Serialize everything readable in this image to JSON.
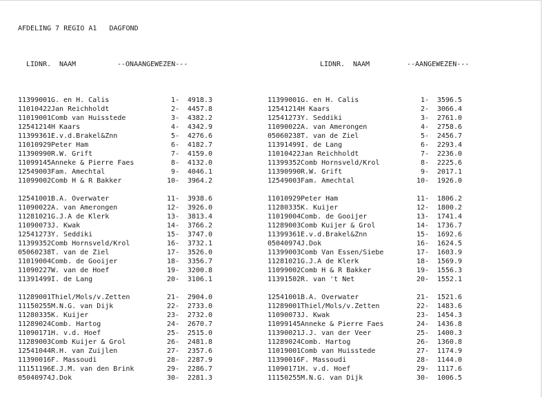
{
  "title_line": "AFDELING 7 REGIO A1   DAGFOND",
  "headers": {
    "left_lidnr": "LIDNR.",
    "left_naam": "NAAM",
    "left_section": "--ONAANGEWEZEN---",
    "right_lidnr": "LIDNR.",
    "right_naam": "NAAM",
    "right_section": "--AANGEWEZEN---"
  },
  "left": [
    {
      "lid": "11399001",
      "naam": "G. en H. Calis",
      "rank": "1-",
      "score": "4918.3"
    },
    {
      "lid": "11010422",
      "naam": "Jan Reichholdt",
      "rank": "2-",
      "score": "4457.8"
    },
    {
      "lid": "11019001",
      "naam": "Comb van Huisstede",
      "rank": "3-",
      "score": "4382.2"
    },
    {
      "lid": "12541214",
      "naam": "H Kaars",
      "rank": "4-",
      "score": "4342.9"
    },
    {
      "lid": "11399361",
      "naam": "E.v.d.Brakel&Znn",
      "rank": "5-",
      "score": "4276.6"
    },
    {
      "lid": "11010929",
      "naam": "Peter Ham",
      "rank": "6-",
      "score": "4182.7"
    },
    {
      "lid": "11390990",
      "naam": "R.W. Grift",
      "rank": "7-",
      "score": "4159.0"
    },
    {
      "lid": "11099145",
      "naam": "Anneke & Pierre Faes",
      "rank": "8-",
      "score": "4132.0"
    },
    {
      "lid": "12549003",
      "naam": "Fam. Amechtal",
      "rank": "9-",
      "score": "4046.1"
    },
    {
      "lid": "11099002",
      "naam": "Comb H & R Bakker",
      "rank": "10-",
      "score": "3964.2"
    },
    {
      "lid": "12541001",
      "naam": "B.A. Overwater",
      "rank": "11-",
      "score": "3938.6"
    },
    {
      "lid": "11090022",
      "naam": "A. van Amerongen",
      "rank": "12-",
      "score": "3926.0"
    },
    {
      "lid": "11281021",
      "naam": "G.J.A de Klerk",
      "rank": "13-",
      "score": "3813.4"
    },
    {
      "lid": "11090073",
      "naam": "J. Kwak",
      "rank": "14-",
      "score": "3766.2"
    },
    {
      "lid": "12541273",
      "naam": "Y. Seddiki",
      "rank": "15-",
      "score": "3747.0"
    },
    {
      "lid": "11399352",
      "naam": "Comb Hornsveld/Krol",
      "rank": "16-",
      "score": "3732.1"
    },
    {
      "lid": "05060238",
      "naam": "T. van de Ziel",
      "rank": "17-",
      "score": "3526.0"
    },
    {
      "lid": "11019004",
      "naam": "Comb. de Gooijer",
      "rank": "18-",
      "score": "3356.7"
    },
    {
      "lid": "11090227",
      "naam": "W. van de Hoef",
      "rank": "19-",
      "score": "3200.8"
    },
    {
      "lid": "11391499",
      "naam": "I. de Lang",
      "rank": "20-",
      "score": "3106.1"
    },
    {
      "lid": "11289001",
      "naam": "Thiel/Mols/v.Zetten",
      "rank": "21-",
      "score": "2904.0"
    },
    {
      "lid": "11150255",
      "naam": "M.N.G. van Dijk",
      "rank": "22-",
      "score": "2733.0"
    },
    {
      "lid": "11280335",
      "naam": "K. Kuijer",
      "rank": "23-",
      "score": "2732.0"
    },
    {
      "lid": "11289024",
      "naam": "Comb. Hartog",
      "rank": "24-",
      "score": "2670.7"
    },
    {
      "lid": "11090171",
      "naam": "H. v.d. Hoef",
      "rank": "25-",
      "score": "2515.0"
    },
    {
      "lid": "11289003",
      "naam": "Comb Kuijer & Grol",
      "rank": "26-",
      "score": "2481.8"
    },
    {
      "lid": "12541044",
      "naam": "R.H. van Zuijlen",
      "rank": "27-",
      "score": "2357.6"
    },
    {
      "lid": "11390016",
      "naam": "F. Massoudi",
      "rank": "28-",
      "score": "2287.9"
    },
    {
      "lid": "11151196",
      "naam": "E.J.M. van den Brink",
      "rank": "29-",
      "score": "2286.7"
    },
    {
      "lid": "05040974",
      "naam": "J.Dok",
      "rank": "30-",
      "score": "2281.3"
    }
  ],
  "right": [
    {
      "lid": "11399001",
      "naam": "G. en H. Calis",
      "rank": "1-",
      "score": "3596.5"
    },
    {
      "lid": "12541214",
      "naam": "H Kaars",
      "rank": "2-",
      "score": "3066.4"
    },
    {
      "lid": "12541273",
      "naam": "Y. Seddiki",
      "rank": "3-",
      "score": "2761.0"
    },
    {
      "lid": "11090022",
      "naam": "A. van Amerongen",
      "rank": "4-",
      "score": "2758.6"
    },
    {
      "lid": "05060238",
      "naam": "T. van de Ziel",
      "rank": "5-",
      "score": "2456.7"
    },
    {
      "lid": "11391499",
      "naam": "I. de Lang",
      "rank": "6-",
      "score": "2293.4"
    },
    {
      "lid": "11010422",
      "naam": "Jan Reichholdt",
      "rank": "7-",
      "score": "2236.0"
    },
    {
      "lid": "11399352",
      "naam": "Comb Hornsveld/Krol",
      "rank": "8-",
      "score": "2225.6"
    },
    {
      "lid": "11390990",
      "naam": "R.W. Grift",
      "rank": "9-",
      "score": "2017.1"
    },
    {
      "lid": "12549003",
      "naam": "Fam. Amechtal",
      "rank": "10-",
      "score": "1926.0"
    },
    {
      "lid": "11010929",
      "naam": "Peter Ham",
      "rank": "11-",
      "score": "1806.2"
    },
    {
      "lid": "11280335",
      "naam": "K. Kuijer",
      "rank": "12-",
      "score": "1800.2"
    },
    {
      "lid": "11019004",
      "naam": "Comb. de Gooijer",
      "rank": "13-",
      "score": "1741.4"
    },
    {
      "lid": "11289003",
      "naam": "Comb Kuijer & Grol",
      "rank": "14-",
      "score": "1736.7"
    },
    {
      "lid": "11399361",
      "naam": "E.v.d.Brakel&Znn",
      "rank": "15-",
      "score": "1692.6"
    },
    {
      "lid": "05040974",
      "naam": "J.Dok",
      "rank": "16-",
      "score": "1624.5"
    },
    {
      "lid": "11399003",
      "naam": "Comb Van Essen/Siebe",
      "rank": "17-",
      "score": "1603.9"
    },
    {
      "lid": "11281021",
      "naam": "G.J.A de Klerk",
      "rank": "18-",
      "score": "1569.9"
    },
    {
      "lid": "11099002",
      "naam": "Comb H & R Bakker",
      "rank": "19-",
      "score": "1556.3"
    },
    {
      "lid": "11391502",
      "naam": "R. van 't Net",
      "rank": "20-",
      "score": "1552.1"
    },
    {
      "lid": "12541001",
      "naam": "B.A. Overwater",
      "rank": "21-",
      "score": "1521.6"
    },
    {
      "lid": "11289001",
      "naam": "Thiel/Mols/v.Zetten",
      "rank": "22-",
      "score": "1483.6"
    },
    {
      "lid": "11090073",
      "naam": "J. Kwak",
      "rank": "23-",
      "score": "1454.3"
    },
    {
      "lid": "11099145",
      "naam": "Anneke & Pierre Faes",
      "rank": "24-",
      "score": "1436.8"
    },
    {
      "lid": "11390021",
      "naam": "J.J. van der Veer",
      "rank": "25-",
      "score": "1400.3"
    },
    {
      "lid": "11289024",
      "naam": "Comb. Hartog",
      "rank": "26-",
      "score": "1360.8"
    },
    {
      "lid": "11019001",
      "naam": "Comb van Huisstede",
      "rank": "27-",
      "score": "1174.9"
    },
    {
      "lid": "11390016",
      "naam": "F. Massoudi",
      "rank": "28-",
      "score": "1144.0"
    },
    {
      "lid": "11090171",
      "naam": "H. v.d. Hoef",
      "rank": "29-",
      "score": "1117.6"
    },
    {
      "lid": "11150255",
      "naam": "M.N.G. van Dijk",
      "rank": "30-",
      "score": "1006.5"
    }
  ]
}
